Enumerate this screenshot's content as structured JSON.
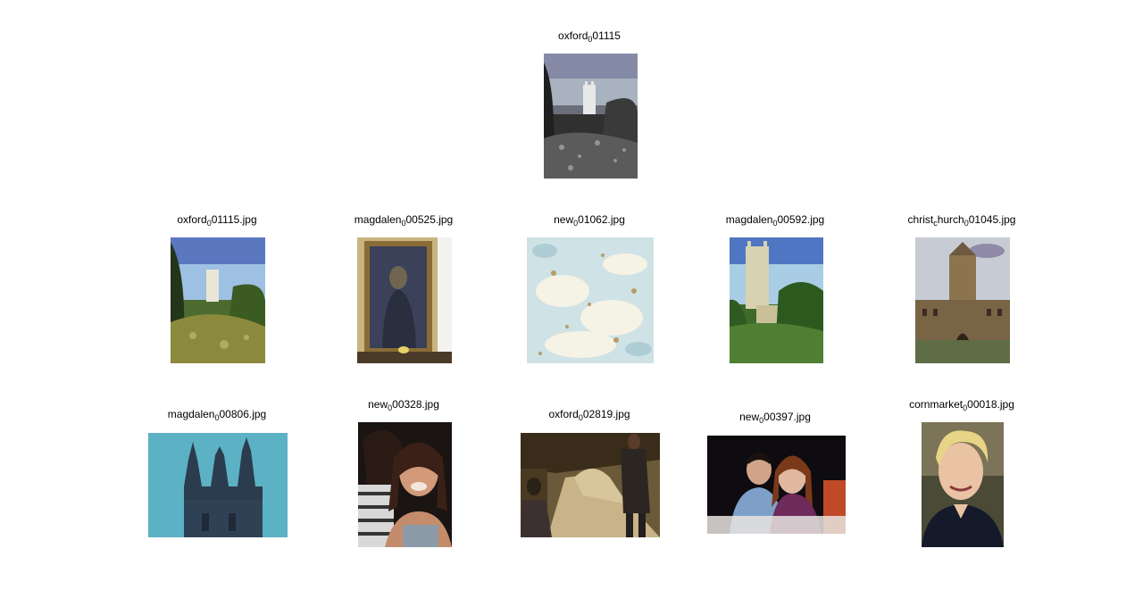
{
  "query": {
    "title": [
      "oxford",
      "0",
      "01115"
    ]
  },
  "results": [
    {
      "title": [
        "oxford",
        "0",
        "01115.jpg"
      ]
    },
    {
      "title": [
        "magdalen",
        "0",
        "00525.jpg"
      ]
    },
    {
      "title": [
        "new",
        "0",
        "01062.jpg"
      ]
    },
    {
      "title": [
        "magdalen",
        "0",
        "00592.jpg"
      ]
    },
    {
      "title": [
        "christ",
        "c",
        "hurch",
        "0",
        "01045.jpg"
      ]
    },
    {
      "title": [
        "magdalen",
        "0",
        "00806.jpg"
      ]
    },
    {
      "title": [
        "new",
        "0",
        "00328.jpg"
      ]
    },
    {
      "title": [
        "oxford",
        "0",
        "02819.jpg"
      ]
    },
    {
      "title": [
        "new",
        "0",
        "00397.jpg"
      ]
    },
    {
      "title": [
        "cornmarket",
        "0",
        "00018.jpg"
      ]
    }
  ]
}
